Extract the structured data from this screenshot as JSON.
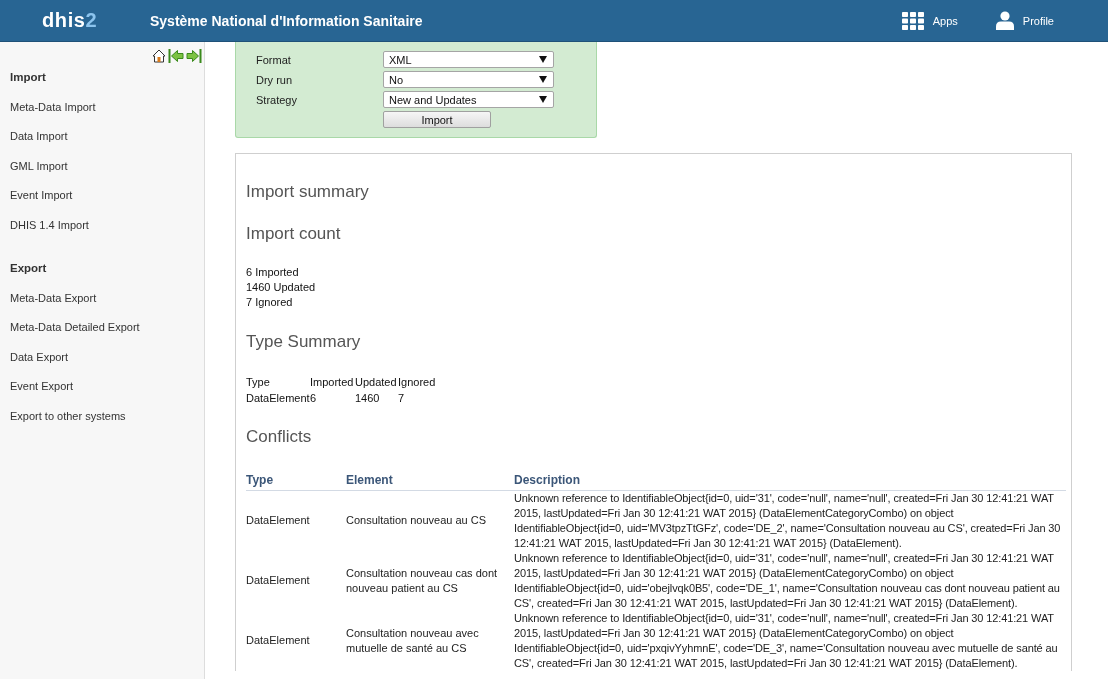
{
  "header": {
    "logo": {
      "text": "dhis",
      "accent": "2"
    },
    "title": "Système National d'Information Sanitaire",
    "menu": [
      {
        "kind": "apps",
        "label": "Apps"
      },
      {
        "kind": "profile",
        "label": "Profile"
      }
    ]
  },
  "sidebar": {
    "sections": [
      {
        "title": "Import",
        "items": [
          "Meta-Data Import",
          "Data Import",
          "GML Import",
          "Event Import",
          "DHIS 1.4 Import"
        ]
      },
      {
        "title": "Export",
        "items": [
          "Meta-Data Export",
          "Meta-Data Detailed Export",
          "Data Export",
          "Event Export",
          "Export to other systems"
        ]
      }
    ]
  },
  "import_form": {
    "fields": [
      {
        "label": "Format",
        "value": "XML"
      },
      {
        "label": "Dry run",
        "value": "No"
      },
      {
        "label": "Strategy",
        "value": "New and Updates"
      }
    ],
    "button": "Import"
  },
  "summary": {
    "title": "Import summary",
    "count_title": "Import count",
    "counts": [
      "6 Imported",
      "1460 Updated",
      "7 Ignored"
    ],
    "type_summary": {
      "title": "Type Summary",
      "columns": [
        "Type",
        "Imported",
        "Updated",
        "Ignored"
      ],
      "rows": [
        [
          "DataElement",
          "6",
          "1460",
          "7"
        ]
      ]
    },
    "conflicts": {
      "title": "Conflicts",
      "columns": [
        "Type",
        "Element",
        "Description"
      ],
      "rows": [
        {
          "type": "DataElement",
          "element": "Consultation nouveau au CS",
          "description": "Unknown reference to IdentifiableObject{id=0, uid='31', code='null', name='null', created=Fri Jan 30 12:41:21 WAT 2015, lastUpdated=Fri Jan 30 12:41:21 WAT 2015} (DataElementCategoryCombo) on object IdentifiableObject{id=0, uid='MV3tpzTtGFz', code='DE_2', name='Consultation nouveau au CS', created=Fri Jan 30 12:41:21 WAT 2015, lastUpdated=Fri Jan 30 12:41:21 WAT 2015} (DataElement)."
        },
        {
          "type": "DataElement",
          "element": "Consultation nouveau cas dont nouveau patient au CS",
          "description": "Unknown reference to IdentifiableObject{id=0, uid='31', code='null', name='null', created=Fri Jan 30 12:41:21 WAT 2015, lastUpdated=Fri Jan 30 12:41:21 WAT 2015} (DataElementCategoryCombo) on object IdentifiableObject{id=0, uid='obejlvqk0B5', code='DE_1', name='Consultation nouveau cas dont nouveau patient au CS', created=Fri Jan 30 12:41:21 WAT 2015, lastUpdated=Fri Jan 30 12:41:21 WAT 2015} (DataElement)."
        },
        {
          "type": "DataElement",
          "element": "Consultation nouveau avec mutuelle de santé au CS",
          "description": "Unknown reference to IdentifiableObject{id=0, uid='31', code='null', name='null', created=Fri Jan 30 12:41:21 WAT 2015, lastUpdated=Fri Jan 30 12:41:21 WAT 2015} (DataElementCategoryCombo) on object IdentifiableObject{id=0, uid='pxqivYyhmnE', code='DE_3', name='Consultation nouveau avec mutuelle de santé au CS', created=Fri Jan 30 12:41:21 WAT 2015, lastUpdated=Fri Jan 30 12:41:21 WAT 2015} (DataElement)."
        }
      ]
    }
  }
}
